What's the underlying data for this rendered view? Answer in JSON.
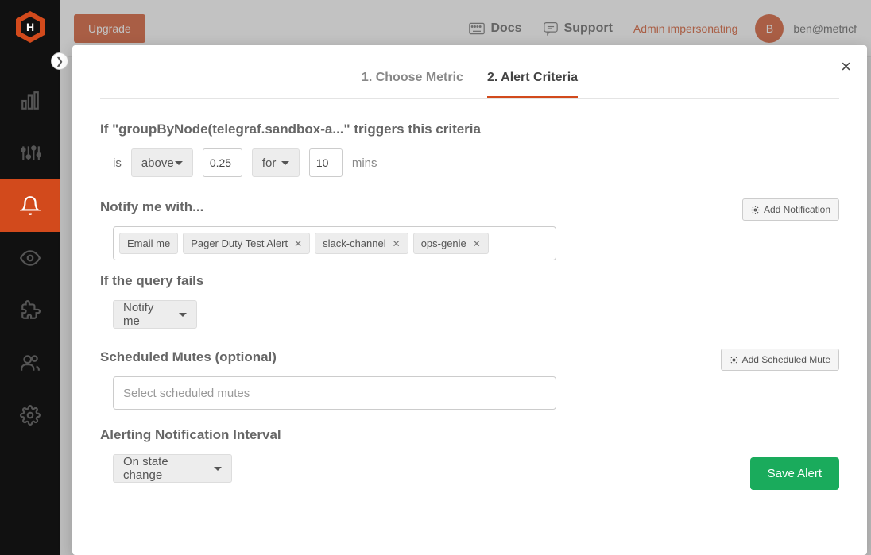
{
  "topbar": {
    "upgrade": "Upgrade",
    "docs": "Docs",
    "support": "Support",
    "admin_impersonating": "Admin impersonating",
    "avatar_letter": "B",
    "user_email": "ben@metricf"
  },
  "modal": {
    "tabs": {
      "tab1": "1. Choose Metric",
      "tab2": "2. Alert Criteria"
    },
    "criteria": {
      "title": "If \"groupByNode(telegraf.sandbox-a...\" triggers this criteria",
      "is_label": "is",
      "condition": "above",
      "threshold": "0.25",
      "for_label": "for",
      "duration": "10",
      "mins_label": "mins"
    },
    "notify": {
      "title": "Notify me with...",
      "add_button": "Add Notification",
      "tags": [
        "Email me",
        "Pager Duty Test Alert",
        "slack-channel",
        "ops-genie"
      ]
    },
    "query_fails": {
      "title": "If the query fails",
      "action": "Notify me"
    },
    "mutes": {
      "title": "Scheduled Mutes (optional)",
      "add_button": "Add Scheduled Mute",
      "placeholder": "Select scheduled mutes"
    },
    "interval": {
      "title": "Alerting Notification Interval",
      "value": "On state change"
    },
    "save_button": "Save Alert"
  }
}
